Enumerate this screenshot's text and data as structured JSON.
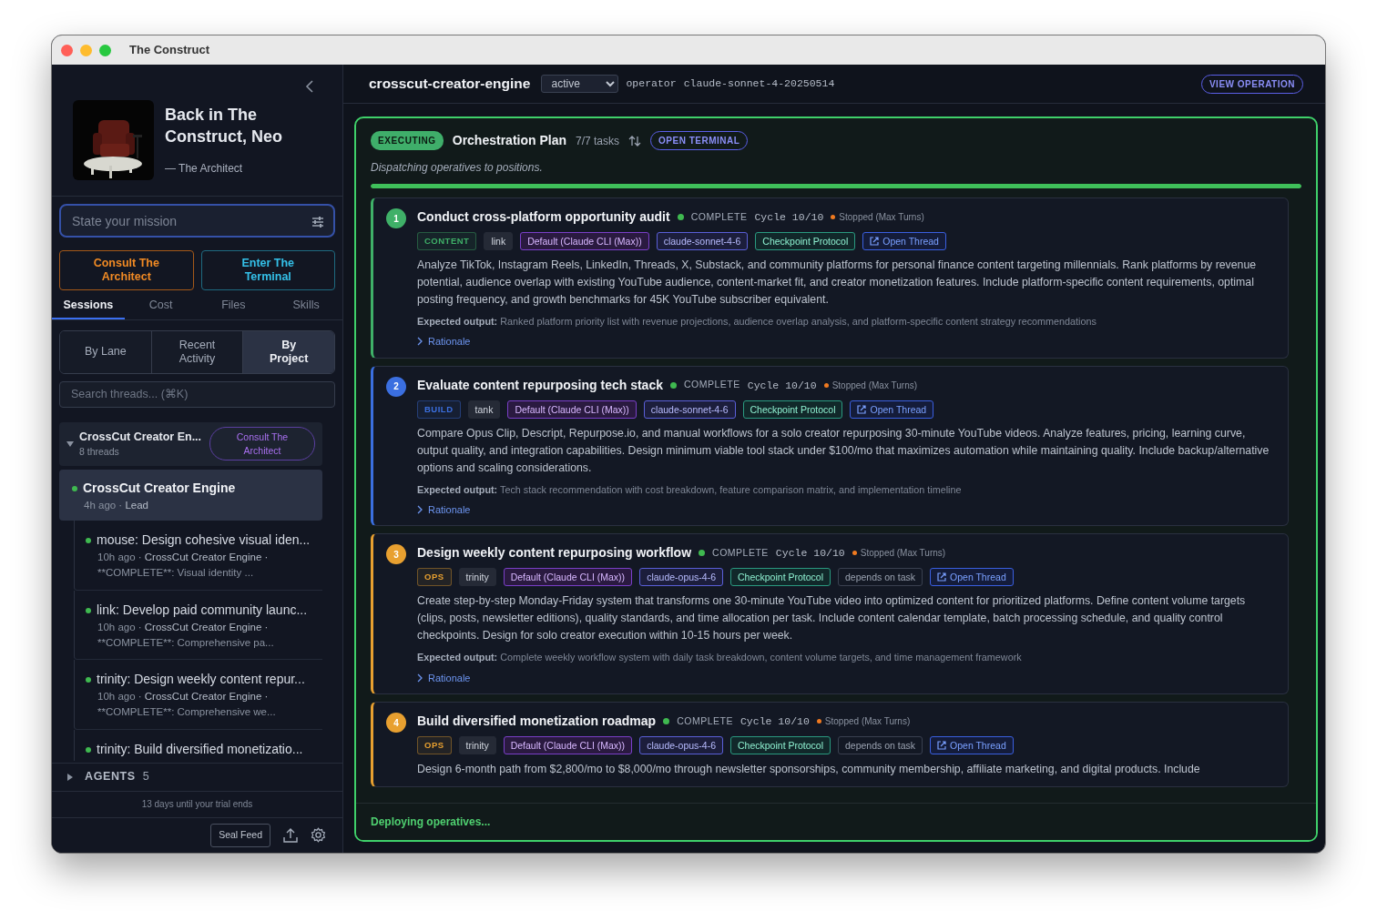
{
  "window": {
    "title": "The Construct"
  },
  "sidebar": {
    "greeting": {
      "title": "Back in The Construct, Neo",
      "attribution": "— The Architect"
    },
    "mission": {
      "placeholder": "State your mission"
    },
    "actions": [
      {
        "label": "Consult The Architect",
        "kind": "architect"
      },
      {
        "label": "Enter The Terminal",
        "kind": "terminal"
      }
    ],
    "tabs": [
      {
        "label": "Sessions",
        "selected": true
      },
      {
        "label": "Cost",
        "selected": false
      },
      {
        "label": "Files",
        "selected": false
      },
      {
        "label": "Skills",
        "selected": false
      }
    ],
    "views": [
      {
        "label": "By Lane",
        "selected": false
      },
      {
        "label": "Recent Activity",
        "selected": false
      },
      {
        "label": "By Project",
        "selected": true
      }
    ],
    "search": {
      "placeholder": "Search threads... (⌘K)"
    },
    "project": {
      "name": "CrossCut Creator En...",
      "count": "8 threads",
      "expanded": true,
      "button": "Consult The Architect"
    },
    "threads": [
      {
        "title": "CrossCut Creator Engine",
        "time": "4h ago ·",
        "meta": "Lead",
        "selected": true,
        "color": "#3fb950"
      },
      {
        "title": "mouse: Design cohesive visual iden...",
        "time": "10h ago ·",
        "meta": "CrossCut Creator Engine  ·",
        "summary": "**COMPLETE**: Visual identity ...",
        "selected": false,
        "color": "#3fb950"
      },
      {
        "title": "link: Develop paid community launc...",
        "time": "10h ago ·",
        "meta": "CrossCut Creator Engine  ·",
        "summary": "**COMPLETE**: Comprehensive pa...",
        "selected": false,
        "color": "#3fb950"
      },
      {
        "title": "trinity: Design weekly content repur...",
        "time": "10h ago ·",
        "meta": "CrossCut Creator Engine  ·",
        "summary": "**COMPLETE**: Comprehensive we...",
        "selected": false,
        "color": "#3fb950"
      },
      {
        "title": "trinity: Build diversified monetizatio...",
        "selected": false,
        "color": "#3fb950"
      }
    ],
    "agents": {
      "label": "AGENTS",
      "count": "5",
      "expanded": false
    },
    "trial": "13 days until your trial ends",
    "footer": {
      "button": "Seal Feed"
    }
  },
  "main": {
    "name": "crosscut-creator-engine",
    "status": "active",
    "operator_label": "operator",
    "model": "claude-sonnet-4-20250514",
    "view_button": "VIEW OPERATION",
    "plan": {
      "badge": "EXECUTING",
      "title": "Orchestration Plan",
      "count": "7/7 tasks",
      "terminal_button": "OPEN TERMINAL",
      "subtitle": "Dispatching operatives to positions.",
      "level": 1.0,
      "tasks": [
        {
          "number": "1",
          "color": "#3fb068",
          "title": "Conduct cross-platform opportunity audit",
          "status": "COMPLETE",
          "cycle": "Cycle 10/10",
          "stopped": "Stopped (Max Turns)",
          "tags": [
            {
              "text": "CONTENT",
              "kind": "category"
            },
            {
              "text": "link",
              "kind": "agent"
            },
            {
              "text": "Default (Claude CLI (Max))",
              "kind": "provider"
            },
            {
              "text": "claude-sonnet-4-6",
              "kind": "model"
            },
            {
              "text": "Checkpoint Protocol",
              "kind": "protocol"
            },
            {
              "text": "Open Thread",
              "kind": "link"
            }
          ],
          "description": "Analyze TikTok, Instagram Reels, LinkedIn, Threads, X, Substack, and community platforms for personal finance content targeting millennials. Rank platforms by revenue potential, audience overlap with existing YouTube audience, content-market fit, and creator monetization features. Include platform-specific content requirements, optimal posting frequency, and growth benchmarks for 45K YouTube subscriber equivalent.",
          "expected": "**Expected output:** Ranked platform priority list with revenue projections, audience overlap analysis, and platform-specific content strategy recommendations",
          "rationale": "Rationale"
        },
        {
          "number": "2",
          "color": "#3b6fe0",
          "title": "Evaluate content repurposing tech stack",
          "status": "COMPLETE",
          "cycle": "Cycle 10/10",
          "stopped": "Stopped (Max Turns)",
          "tags": [
            {
              "text": "BUILD",
              "kind": "category"
            },
            {
              "text": "tank",
              "kind": "agent"
            },
            {
              "text": "Default (Claude CLI (Max))",
              "kind": "provider"
            },
            {
              "text": "claude-sonnet-4-6",
              "kind": "model"
            },
            {
              "text": "Checkpoint Protocol",
              "kind": "protocol"
            },
            {
              "text": "Open Thread",
              "kind": "link"
            }
          ],
          "description": "Compare Opus Clip, Descript, Repurpose.io, and manual workflows for a solo creator repurposing 30-minute YouTube videos. Analyze features, pricing, learning curve, output quality, and integration capabilities. Design minimum viable tool stack under $100/mo that maximizes automation while maintaining quality. Include backup/alternative options and scaling considerations.",
          "expected": "**Expected output:** Tech stack recommendation with cost breakdown, feature comparison matrix, and implementation timeline",
          "rationale": "Rationale"
        },
        {
          "number": "3",
          "color": "#e8a030",
          "title": "Design weekly content repurposing workflow",
          "status": "COMPLETE",
          "cycle": "Cycle 10/10",
          "stopped": "Stopped (Max Turns)",
          "tags": [
            {
              "text": "OPS",
              "kind": "category"
            },
            {
              "text": "trinity",
              "kind": "agent"
            },
            {
              "text": "Default (Claude CLI (Max))",
              "kind": "provider"
            },
            {
              "text": "claude-opus-4-6",
              "kind": "model"
            },
            {
              "text": "Checkpoint Protocol",
              "kind": "protocol"
            },
            {
              "text": "depends on task",
              "kind": "dependency"
            },
            {
              "text": "Open Thread",
              "kind": "link"
            }
          ],
          "description": "Create step-by-step Monday-Friday system that transforms one 30-minute YouTube video into optimized content for prioritized platforms. Define content volume targets (clips, posts, newsletter editions), quality standards, and time allocation per task. Include content calendar template, batch processing schedule, and quality control checkpoints. Design for solo creator execution within 10-15 hours per week.",
          "expected": "**Expected output:** Complete weekly workflow system with daily task breakdown, content volume targets, and time management framework",
          "rationale": "Rationale"
        },
        {
          "number": "4",
          "color": "#e8a030",
          "title": "Build diversified monetization roadmap",
          "status": "COMPLETE",
          "cycle": "Cycle 10/10",
          "stopped": "Stopped (Max Turns)",
          "tags": [
            {
              "text": "OPS",
              "kind": "category"
            },
            {
              "text": "trinity",
              "kind": "agent"
            },
            {
              "text": "Default (Claude CLI (Max))",
              "kind": "provider"
            },
            {
              "text": "claude-opus-4-6",
              "kind": "model"
            },
            {
              "text": "Checkpoint Protocol",
              "kind": "protocol"
            },
            {
              "text": "depends on task",
              "kind": "dependency"
            },
            {
              "text": "Open Thread",
              "kind": "link"
            }
          ],
          "description": "Design 6-month path from $2,800/mo to $8,000/mo through newsletter sponsorships, community membership, affiliate marketing, and digital products. Include"
        }
      ]
    },
    "footer": "Deploying operatives..."
  }
}
